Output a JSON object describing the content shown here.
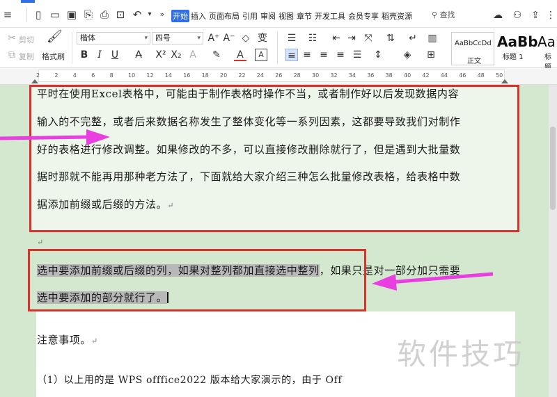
{
  "menu": {
    "tabs": [
      "开始",
      "插入",
      "页面布局",
      "引用",
      "审阅",
      "视图",
      "章节",
      "开发工具",
      "会员专享",
      "稻壳资源"
    ],
    "active_tab": "开始",
    "search_label": "查找"
  },
  "ribbon": {
    "cut_label": "剪切",
    "copy_label": "复制",
    "format_painter_label": "格式刷",
    "font_name": "楷体",
    "font_size": "四号",
    "styles": {
      "normal_preview": "AaBbCcDd",
      "normal_label": "正文",
      "heading1_preview": "AaBb",
      "heading1_label": "标题 1",
      "heading2_preview": "AaI",
      "heading2_label": "标题"
    }
  },
  "ruler": {
    "ticks": [
      "2",
      "2",
      "4",
      "6",
      "8",
      "10",
      "12",
      "14",
      "16",
      "18",
      "20",
      "22",
      "24",
      "26",
      "28",
      "30",
      "32",
      "34",
      "36",
      "38",
      "40",
      "42",
      "44",
      "46",
      "48",
      "50"
    ]
  },
  "document": {
    "para1_lines": [
      "平时在使用Excel表格中，可能由于制作表格时操作不当，或者制作好以后发现数据内容",
      "输入的不完整，或者后来数据名称发生了整体变化等一系列因素，这都要导致我们对制作",
      "好的表格进行修改调整。如果修改的不多，可以直接修改删除就行了，但是遇到大批量数",
      "据时那就不能再用那种老方法了，下面就给大家介绍三种怎么批量修改表格，给表格中数",
      "据添加前缀或后缀的方法。"
    ],
    "para2_line1_selected": "选中要添加前缀或后缀的列，如果对整列都加直接选中整列",
    "para2_line1_rest": "，如果只是对一部分加只需要",
    "para2_line2_selected": "选中要添加的部分就行了。",
    "para3": "注意事项。",
    "para4": "（1）以上用的是 WPS offfice2022 版本给大家演示的，由于 Off",
    "paragraph_mark": "↵",
    "watermark": "软件技巧"
  },
  "colors": {
    "accent": "#2f6fe8",
    "annotation_red": "#d9322b",
    "annotation_magenta": "#e93fe0",
    "page_green": "#d3e8cf",
    "selection_gray": "#b8b8b8"
  }
}
